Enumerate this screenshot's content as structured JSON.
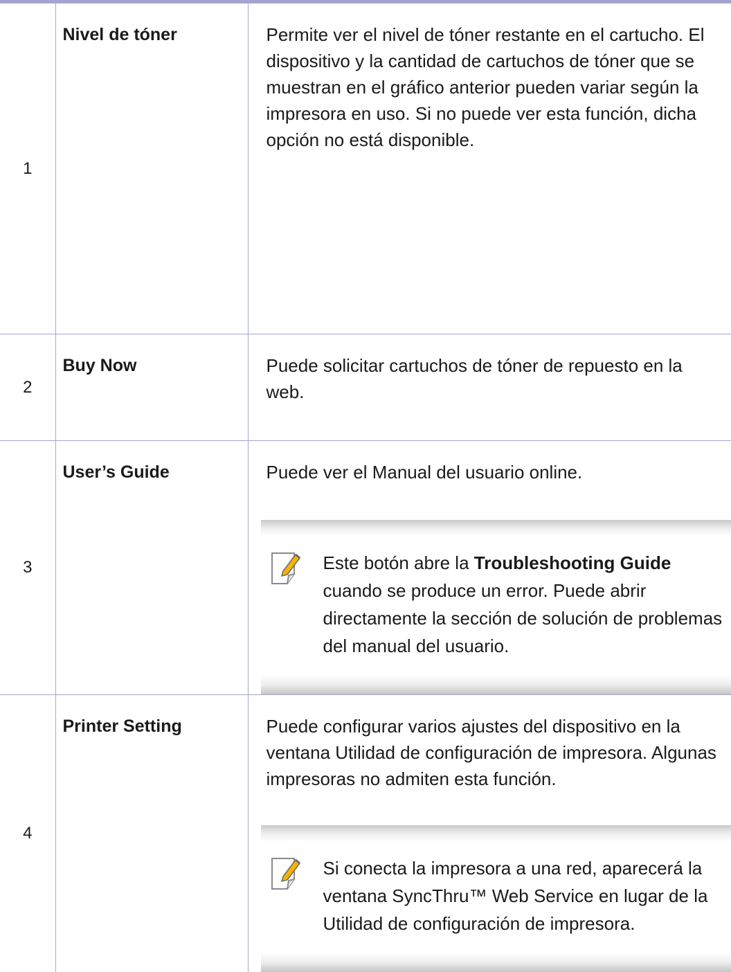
{
  "rows": [
    {
      "number": "1",
      "name": "Nivel de tóner",
      "description": "Permite ver el nivel de tóner restante en el cartucho. El dispositivo y la cantidad de cartuchos de tóner que se muestran en el gráfico anterior pueden variar según la impresora en uso. Si no puede ver esta función, dicha opción no está disponible."
    },
    {
      "number": "2",
      "name": "Buy Now",
      "description": "Puede solicitar cartuchos de tóner de repuesto en la web."
    },
    {
      "number": "3",
      "name": "User’s Guide",
      "description": "Puede ver el Manual del usuario online.",
      "note": {
        "icon": "note-pencil-icon",
        "before": "Este botón abre la ",
        "bold": "Troubleshooting Guide",
        "after": " cuando se produce un error. Puede abrir directamente la sección de solución de problemas del manual del usuario."
      }
    },
    {
      "number": "4",
      "name": "Printer Setting",
      "description": "Puede configurar varios ajustes del dispositivo en la ventana Utilidad de configuración de impresora. Algunas impresoras no admiten esta función.",
      "note": {
        "icon": "note-pencil-icon",
        "text": "Si conecta la impresora a una red, aparecerá la ventana SyncThru™ Web Service en lugar de la Utilidad de configuración de impresora."
      }
    }
  ],
  "colors": {
    "rule": "#a4a4d0",
    "text": "#1a1a1a",
    "note_shade": "#c9c9c9",
    "icon_accent": "#f5b400"
  }
}
